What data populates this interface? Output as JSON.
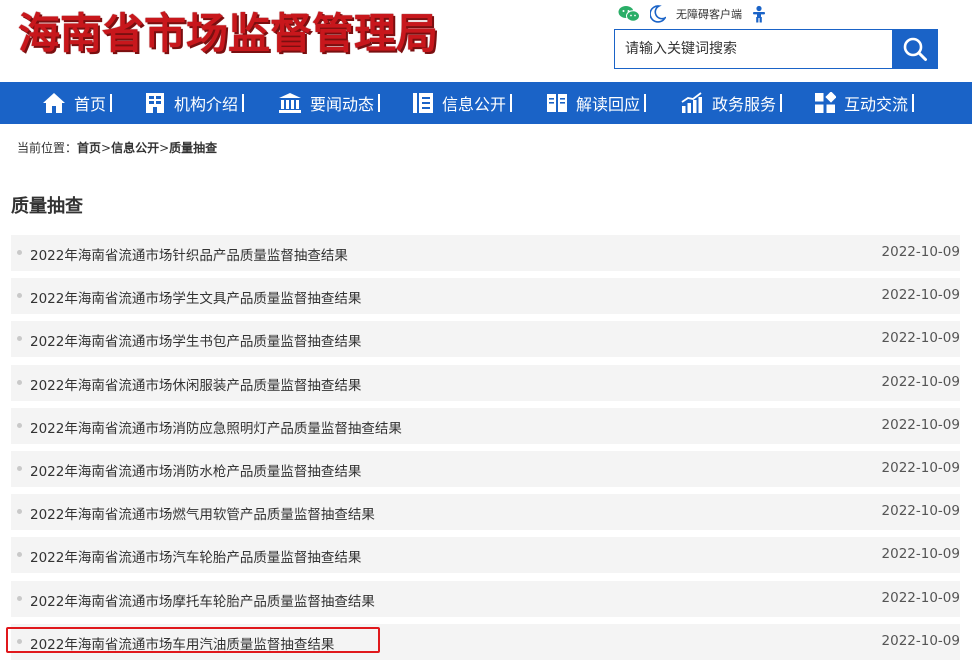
{
  "header": {
    "logo_text": "海南省市场监督管理局",
    "accessibility_label": "无障碍客户端",
    "search": {
      "placeholder": "请输入关键词搜索"
    }
  },
  "nav": {
    "items": [
      {
        "label": "首页",
        "icon": "home-icon"
      },
      {
        "label": "机构介绍",
        "icon": "building-icon"
      },
      {
        "label": "要闻动态",
        "icon": "bank-icon"
      },
      {
        "label": "信息公开",
        "icon": "document-icon"
      },
      {
        "label": "解读回应",
        "icon": "book-icon"
      },
      {
        "label": "政务服务",
        "icon": "chart-icon"
      },
      {
        "label": "互动交流",
        "icon": "grid-icon"
      }
    ]
  },
  "breadcrumb": {
    "prefix": "当前位置：",
    "items": [
      "首页",
      "信息公开",
      "质量抽查"
    ],
    "separator": ">"
  },
  "section": {
    "title": "质量抽查",
    "items": [
      {
        "title": "2022年海南省流通市场针织品产品质量监督抽查结果",
        "date": "2022-10-09"
      },
      {
        "title": "2022年海南省流通市场学生文具产品质量监督抽查结果",
        "date": "2022-10-09"
      },
      {
        "title": "2022年海南省流通市场学生书包产品质量监督抽查结果",
        "date": "2022-10-09"
      },
      {
        "title": "2022年海南省流通市场休闲服装产品质量监督抽查结果",
        "date": "2022-10-09"
      },
      {
        "title": "2022年海南省流通市场消防应急照明灯产品质量监督抽查结果",
        "date": "2022-10-09"
      },
      {
        "title": "2022年海南省流通市场消防水枪产品质量监督抽查结果",
        "date": "2022-10-09"
      },
      {
        "title": "2022年海南省流通市场燃气用软管产品质量监督抽查结果",
        "date": "2022-10-09"
      },
      {
        "title": "2022年海南省流通市场汽车轮胎产品质量监督抽查结果",
        "date": "2022-10-09"
      },
      {
        "title": "2022年海南省流通市场摩托车轮胎产品质量监督抽查结果",
        "date": "2022-10-09"
      },
      {
        "title": "2022年海南省流通市场车用汽油质量监督抽查结果",
        "date": "2022-10-09"
      }
    ]
  },
  "colors": {
    "brand_blue": "#1a63c7",
    "logo_red": "#c8171c",
    "highlight_red": "#e0181c",
    "wechat_green": "#2aae67"
  }
}
